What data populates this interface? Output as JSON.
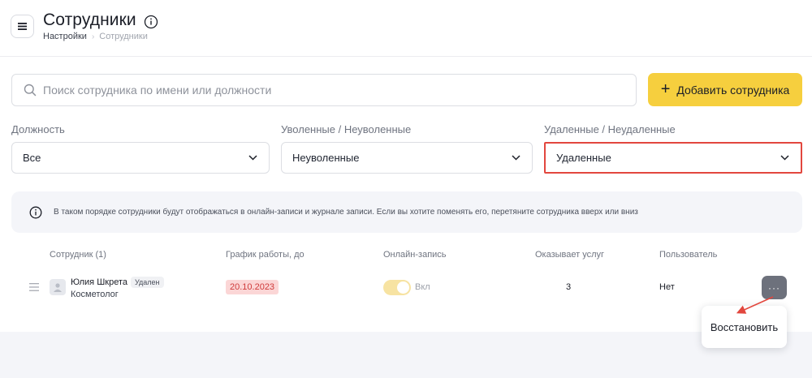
{
  "header": {
    "title": "Сотрудники",
    "breadcrumb": {
      "parent": "Настройки",
      "current": "Сотрудники"
    }
  },
  "search": {
    "placeholder": "Поиск сотрудника по имени или должности"
  },
  "add_button": {
    "label": "Добавить сотрудника",
    "color": "#f6cf3e"
  },
  "filters": [
    {
      "label": "Должность",
      "value": "Все"
    },
    {
      "label": "Уволенные / Неуволенные",
      "value": "Неуволенные"
    },
    {
      "label": "Удаленные / Неудаленные",
      "value": "Удаленные",
      "highlighted": true,
      "highlight_color": "#e2473e"
    }
  ],
  "banner": {
    "text": "В таком порядке сотрудники будут отображаться в онлайн-записи и журнале записи. Если вы хотите поменять его, перетяните сотрудника вверх или вниз"
  },
  "table": {
    "headers": [
      "Сотрудник (1)",
      "График работы, до",
      "Онлайн-запись",
      "Оказывает услуг",
      "Пользователь"
    ],
    "rows": [
      {
        "name": "Юлия Шкрета",
        "status_badge": "Удален",
        "role": "Косметолог",
        "schedule_until": "20.10.2023",
        "online_booking": {
          "enabled": true,
          "label": "Вкл"
        },
        "services_count": "3",
        "user": "Нет",
        "more": "···"
      }
    ]
  },
  "context_menu": {
    "items": [
      "Восстановить"
    ]
  },
  "icons": [
    "menu-icon",
    "info-icon",
    "search-icon",
    "plus-icon",
    "chevron-down-icon",
    "drag-handle-icon",
    "avatar-icon",
    "more-icon"
  ]
}
